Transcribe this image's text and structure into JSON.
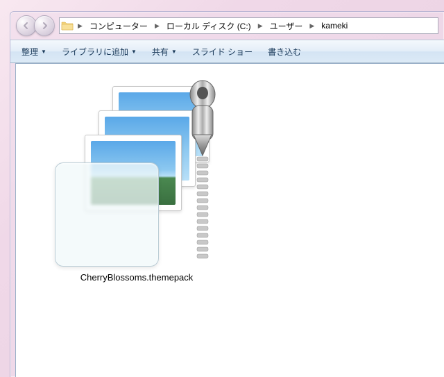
{
  "breadcrumb": {
    "items": [
      "コンピューター",
      "ローカル ディスク (C:)",
      "ユーザー",
      "kameki"
    ]
  },
  "toolbar": {
    "organize": "整理",
    "add_to_library": "ライブラリに追加",
    "share": "共有",
    "slideshow": "スライド ショー",
    "burn": "書き込む"
  },
  "file": {
    "name": "CherryBlossoms.themepack"
  }
}
